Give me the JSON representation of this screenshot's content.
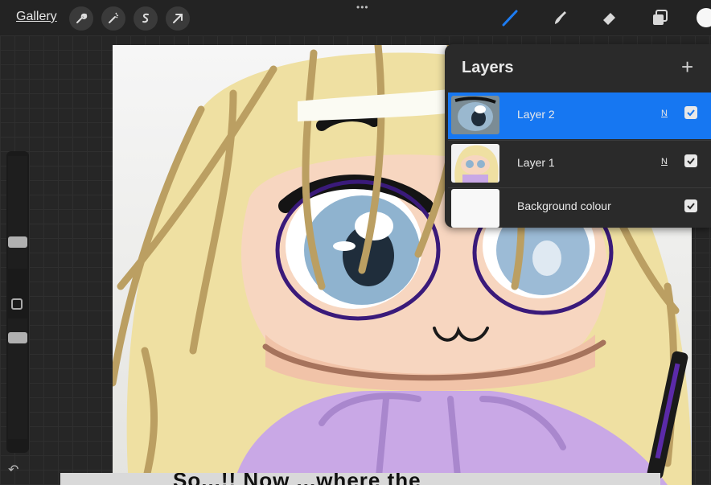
{
  "toolbar": {
    "gallery_label": "Gallery",
    "left_tools": [
      "wrench-icon",
      "magic-wand-icon",
      "selection-icon",
      "transform-arrow-icon"
    ],
    "more_dots": "•••",
    "right_tools": [
      "brush-icon",
      "smudge-icon",
      "eraser-icon",
      "layers-icon"
    ],
    "brush_color": "#1d7cf2",
    "current_color": "#f7f7f7"
  },
  "layers_panel": {
    "title": "Layers",
    "add_label": "+",
    "layers": [
      {
        "name": "Layer 2",
        "mode": "N",
        "visible": true,
        "selected": true
      },
      {
        "name": "Layer 1",
        "mode": "N",
        "visible": true,
        "selected": false
      },
      {
        "name": "Background colour",
        "mode": "",
        "visible": true,
        "selected": false
      }
    ]
  },
  "sidebar": {
    "undo_label": "↶"
  },
  "subtitle_text": "So...!! Now ...where the"
}
